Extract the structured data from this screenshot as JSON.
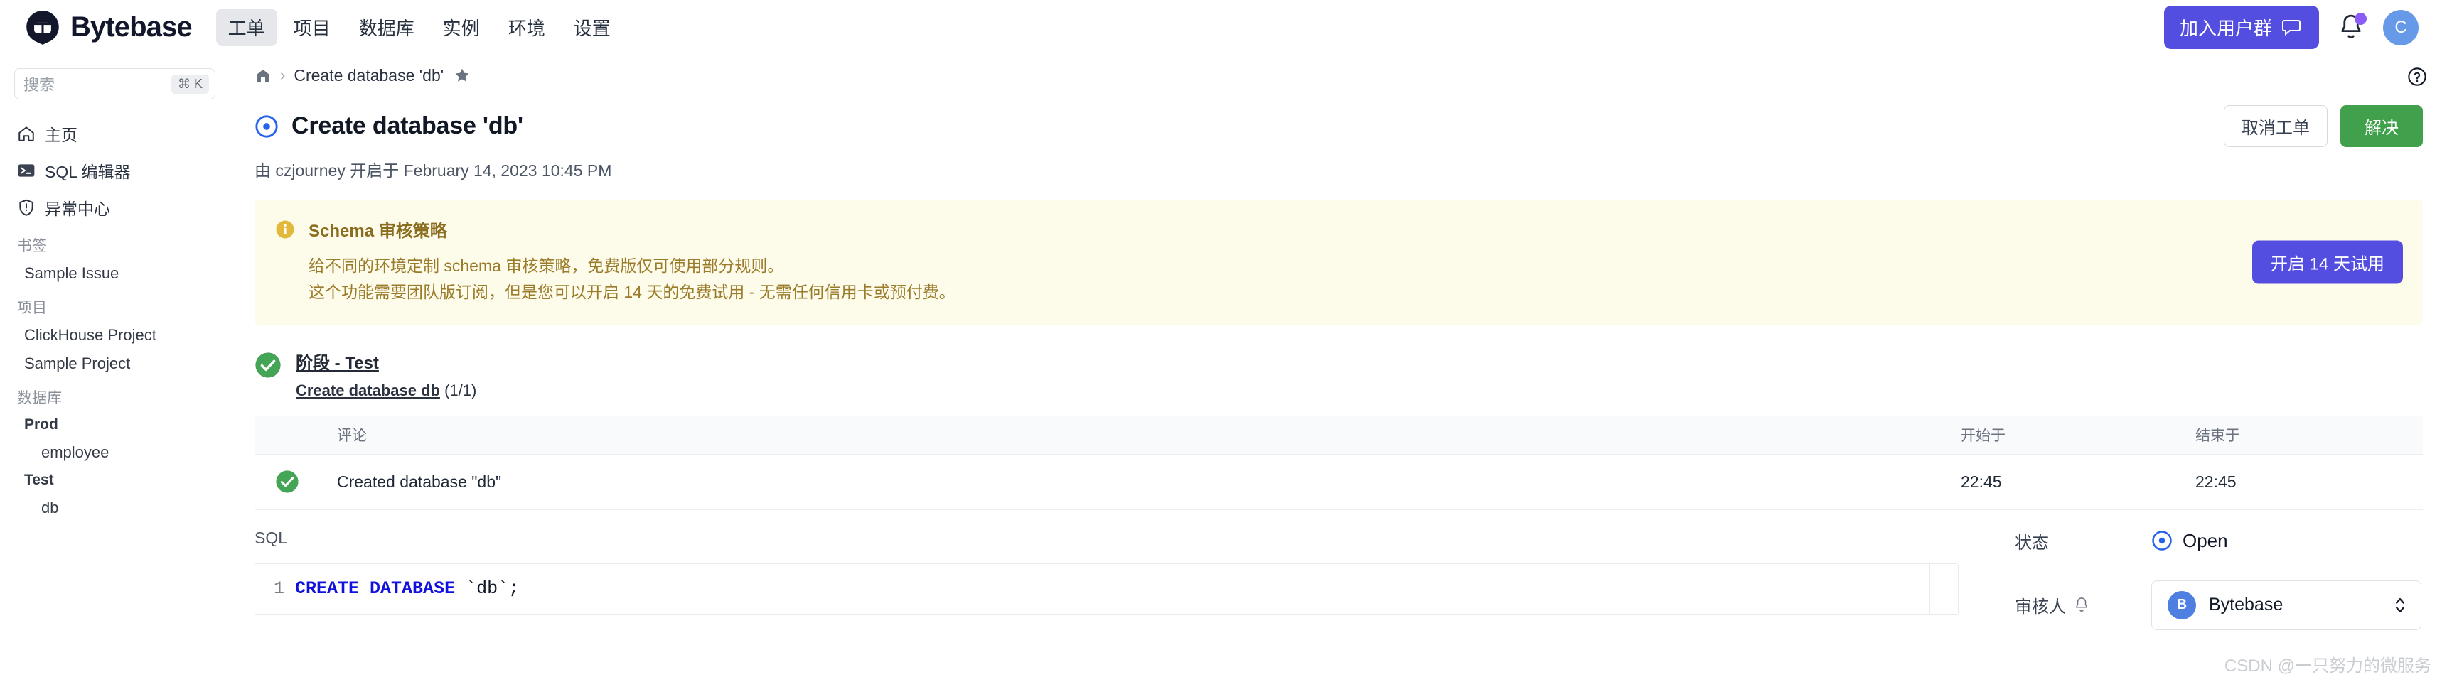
{
  "topnav": {
    "brand_name": "Bytebase",
    "items": [
      {
        "label": "工单",
        "active": true
      },
      {
        "label": "项目",
        "active": false
      },
      {
        "label": "数据库",
        "active": false
      },
      {
        "label": "实例",
        "active": false
      },
      {
        "label": "环境",
        "active": false
      },
      {
        "label": "设置",
        "active": false
      }
    ],
    "join_label": "加入用户群",
    "avatar_initial": "C"
  },
  "sidebar": {
    "search_placeholder": "搜索",
    "search_shortcut": "⌘ K",
    "links": [
      {
        "label": "主页",
        "icon": "home-icon"
      },
      {
        "label": "SQL 编辑器",
        "icon": "terminal-icon"
      },
      {
        "label": "异常中心",
        "icon": "shield-alert-icon"
      }
    ],
    "bookmarks_header": "书签",
    "bookmarks": [
      "Sample Issue"
    ],
    "projects_header": "项目",
    "projects": [
      "ClickHouse Project",
      "Sample Project"
    ],
    "databases_header": "数据库",
    "db_groups": [
      {
        "env": "Prod",
        "databases": [
          "employee"
        ]
      },
      {
        "env": "Test",
        "databases": [
          "db"
        ]
      }
    ]
  },
  "breadcrumb": {
    "home": "home-icon",
    "separator": "›",
    "current": "Create database 'db'"
  },
  "issue": {
    "title": "Create database 'db'",
    "status_icon": "open-circle-icon",
    "cancel_label": "取消工单",
    "resolve_label": "解决",
    "subtitle": "由 czjourney 开启于 February 14, 2023 10:45 PM",
    "subtitle_author": "czjourney"
  },
  "banner": {
    "icon": "info-circle-icon",
    "title": "Schema 审核策略",
    "line1": "给不同的环境定制 schema 审核策略，免费版仅可使用部分规则。",
    "line2": "这个功能需要团队版订阅，但是您可以开启 14 天的免费试用 - 无需任何信用卡或预付费。",
    "cta_label": "开启 14 天试用",
    "bg_color": "#fdfbea",
    "accent_color": "#e3b93b"
  },
  "stage": {
    "name": "阶段 - Test",
    "task_link": "Create database db",
    "task_count": "(1/1)"
  },
  "table": {
    "columns": [
      "",
      "评论",
      "开始于",
      "结束于"
    ],
    "rows": [
      {
        "status": "check-success",
        "comment": "Created database \"db\"",
        "started": "22:45",
        "ended": "22:45"
      }
    ]
  },
  "sql": {
    "label": "SQL",
    "line_number": "1",
    "keyword": "CREATE DATABASE",
    "rest": " `db`;"
  },
  "details": {
    "status_key": "状态",
    "status_value": "Open",
    "assignee_key": "审核人",
    "assignee_name": "Bytebase",
    "assignee_initial": "B"
  },
  "watermark": "CSDN @一只努力的微服务"
}
